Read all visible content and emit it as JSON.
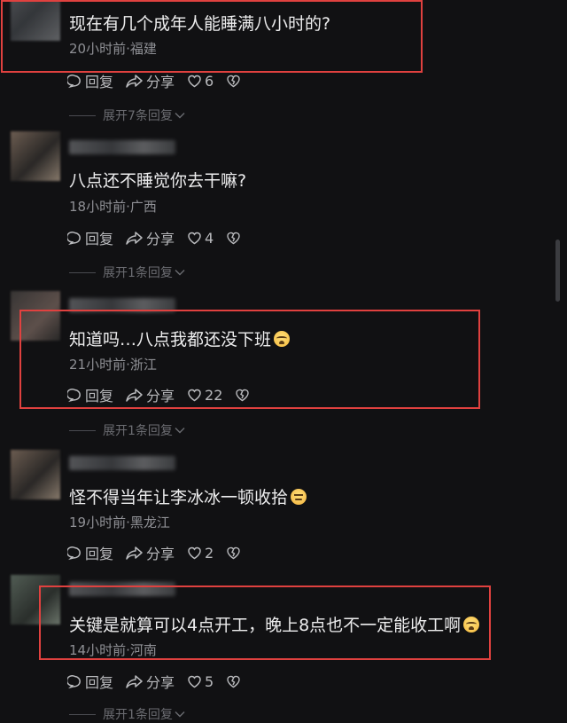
{
  "comments": [
    {
      "text": "现在有几个成年人能睡满八小时的?",
      "meta": "20小时前·福建",
      "reply_label": "回复",
      "share_label": "分享",
      "likes": "6",
      "expand": "展开7条回复",
      "highlighted": true
    },
    {
      "text": "八点还不睡觉你去干嘛?",
      "meta": "18小时前·广西",
      "reply_label": "回复",
      "share_label": "分享",
      "likes": "4",
      "expand": "展开1条回复",
      "highlighted": false
    },
    {
      "text": "知道吗…八点我都还没下班",
      "emoji": "crying-face",
      "meta": "21小时前·浙江",
      "reply_label": "回复",
      "share_label": "分享",
      "likes": "22",
      "expand": "展开1条回复",
      "highlighted": true
    },
    {
      "text": "怪不得当年让李冰冰一顿收拾",
      "emoji": "smirk-face",
      "meta": "19小时前·黑龙江",
      "reply_label": "回复",
      "share_label": "分享",
      "likes": "2",
      "highlighted": false
    },
    {
      "text": "关键是就算可以4点开工，晚上8点也不一定能收工啊",
      "emoji": "crying-face",
      "meta": "14小时前·河南",
      "reply_label": "回复",
      "share_label": "分享",
      "likes": "5",
      "expand": "展开1条回复",
      "highlighted": true
    }
  ],
  "colors": {
    "background": "#111113",
    "highlight_border": "#e0413f",
    "meta_text": "#8f9095"
  },
  "icons": [
    "comment-icon",
    "share-icon",
    "heart-icon",
    "broken-heart-icon",
    "chevron-down-icon"
  ]
}
